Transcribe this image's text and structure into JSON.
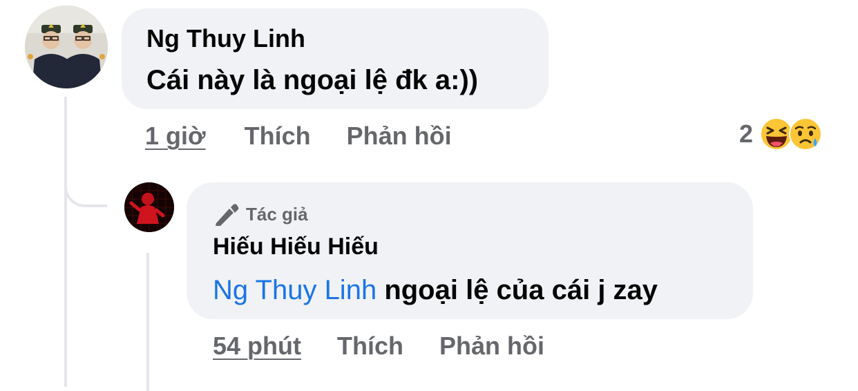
{
  "comment": {
    "author": "Ng Thuy Linh",
    "text": "Cái này là ngoại lệ đk a:))",
    "time": "1 giờ",
    "like_label": "Thích",
    "reply_label": "Phản hồi",
    "reactions": {
      "count": "2",
      "emojis": [
        "laughing-emoji-icon",
        "sad-tear-emoji-icon"
      ]
    }
  },
  "reply": {
    "badge": "Tác giả",
    "badge_icon": "pen-icon",
    "author": "Hiếu Hiếu Hiếu",
    "mention": "Ng Thuy Linh",
    "text": "ngoại lệ của cái j zay",
    "time": "54 phút",
    "like_label": "Thích",
    "reply_label": "Phản hồi"
  },
  "colors": {
    "bubble": "#f0f2f5",
    "mention": "#1b74e4",
    "meta": "#65676b",
    "thread_line": "#e4e6eb"
  }
}
